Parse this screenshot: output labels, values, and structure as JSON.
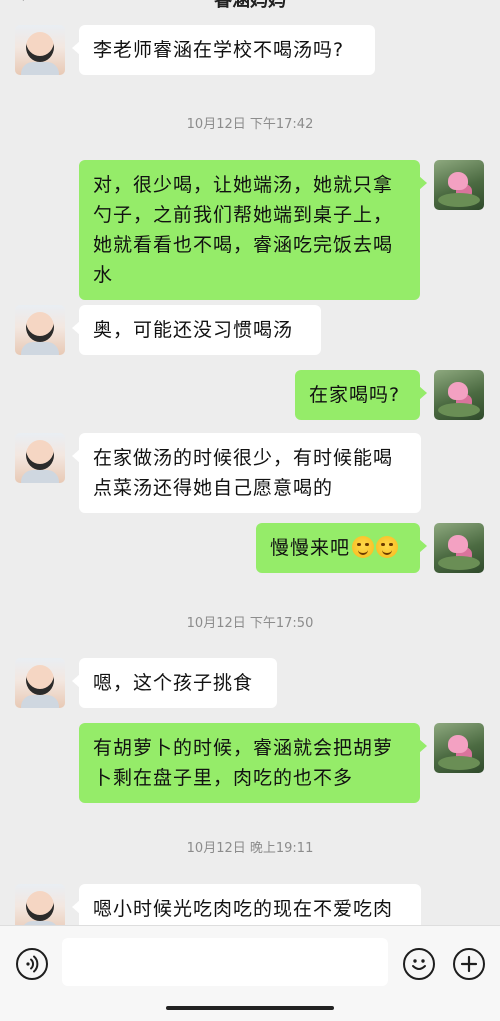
{
  "header": {
    "back_label": "‹",
    "title": "睿涵妈妈"
  },
  "messages": [
    {
      "side": "left",
      "text": "李老师睿涵在学校不喝汤吗?"
    },
    {
      "side": "right",
      "text": "对，很少喝，让她端汤，她就只拿勺子，之前我们帮她端到桌子上，她就看看也不喝，睿涵吃完饭去喝水"
    },
    {
      "side": "left",
      "text": "奥，可能还没习惯喝汤"
    },
    {
      "side": "right",
      "text": "在家喝吗?"
    },
    {
      "side": "left",
      "text": "在家做汤的时候很少，有时候能喝点菜汤还得她自己愿意喝的"
    },
    {
      "side": "right",
      "text": "慢慢来吧"
    },
    {
      "side": "left",
      "text": "嗯，这个孩子挑食"
    },
    {
      "side": "right",
      "text": "有胡萝卜的时候，睿涵就会把胡萝卜剩在盘子里，肉吃的也不多"
    },
    {
      "side": "left",
      "text": "嗯小时候光吃肉吃的现在不爱吃肉"
    }
  ],
  "timestamps": [
    "10月12日 下午17:42",
    "10月12日 下午17:50",
    "10月12日 晚上19:11"
  ],
  "input": {
    "value": "",
    "placeholder": ""
  },
  "icons": {
    "voice": "voice-icon",
    "emoji": "emoji-icon",
    "plus": "plus-icon",
    "child_avatar": "child-avatar",
    "lotus_avatar": "lotus-avatar"
  },
  "colors": {
    "background": "#ededed",
    "sent_bubble": "#95ec69",
    "received_bubble": "#ffffff"
  }
}
